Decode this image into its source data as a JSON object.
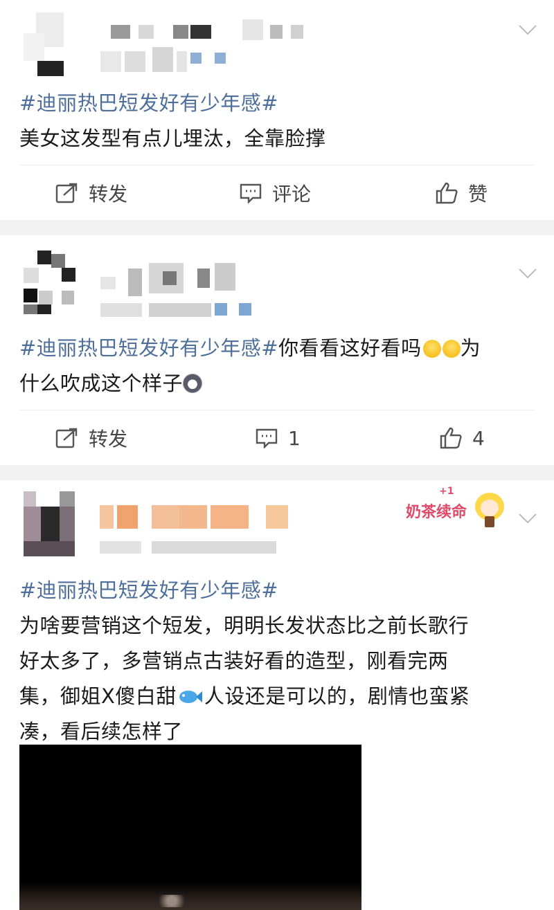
{
  "posts": [
    {
      "hashtag": "#迪丽热巴短发好有少年感#",
      "body": "美女这发型有点儿埋汰，全靠脸撑",
      "actions": {
        "repost": "转发",
        "comment": "评论",
        "like": "赞"
      }
    },
    {
      "hashtag": "#迪丽热巴短发好有少年感#",
      "body_line1": "你看看这好看吗",
      "body_line1_end": "为",
      "body_line2": "什么吹成这个样子",
      "actions": {
        "repost": "转发",
        "comment": "1",
        "like": "4"
      }
    },
    {
      "hashtag": "#迪丽热巴短发好有少年感#",
      "lines": [
        "为啥要营销这个短发，明明长发状态比之前长歌行",
        "好太多了，多营销点古装好看的造型，刚看完两",
        "集，御姐X傻白甜",
        "人设还是可以的，剧情也蛮紧",
        "凑，看后续怎样了"
      ],
      "badge": {
        "text": "奶茶续命",
        "plus": "+1"
      }
    }
  ],
  "colors": {
    "hashtag": "#4d6f99",
    "text": "#1a1a1a",
    "separator": "#f2f2f2"
  },
  "icons": [
    "more-chevron-icon",
    "repost-icon",
    "comment-icon",
    "like-icon",
    "sad-sweat-emoji-icon",
    "husky-emoji-icon",
    "fish-emoji-icon"
  ]
}
